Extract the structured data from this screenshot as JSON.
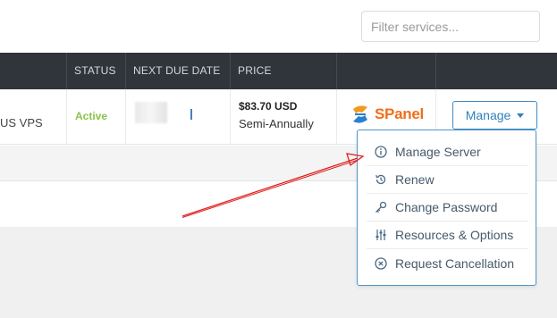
{
  "filter": {
    "placeholder": "Filter services..."
  },
  "table": {
    "headers": [
      "",
      "STATUS",
      "NEXT DUE DATE",
      "PRICE",
      "",
      ""
    ],
    "row": {
      "product_fragment": "US VPS",
      "status": "Active",
      "status_color": "#8bc34a",
      "price_amount": "$83.70 USD",
      "price_cycle": "Semi-Annually",
      "logo_text": "SPanel",
      "manage_label": "Manage"
    }
  },
  "dropdown": {
    "items": [
      {
        "label": "Manage Server",
        "icon": "info-circle-icon"
      },
      {
        "label": "Renew",
        "icon": "history-icon"
      },
      {
        "label": "Change Password",
        "icon": "key-icon"
      },
      {
        "label": "Resources & Options",
        "icon": "sliders-icon"
      },
      {
        "label": "Request Cancellation",
        "icon": "times-circle-icon"
      }
    ]
  },
  "colors": {
    "header_bg": "#30343b",
    "accent": "#2f80bd",
    "brand": "#f06f1a",
    "annotation_arrow": "#e02020"
  }
}
